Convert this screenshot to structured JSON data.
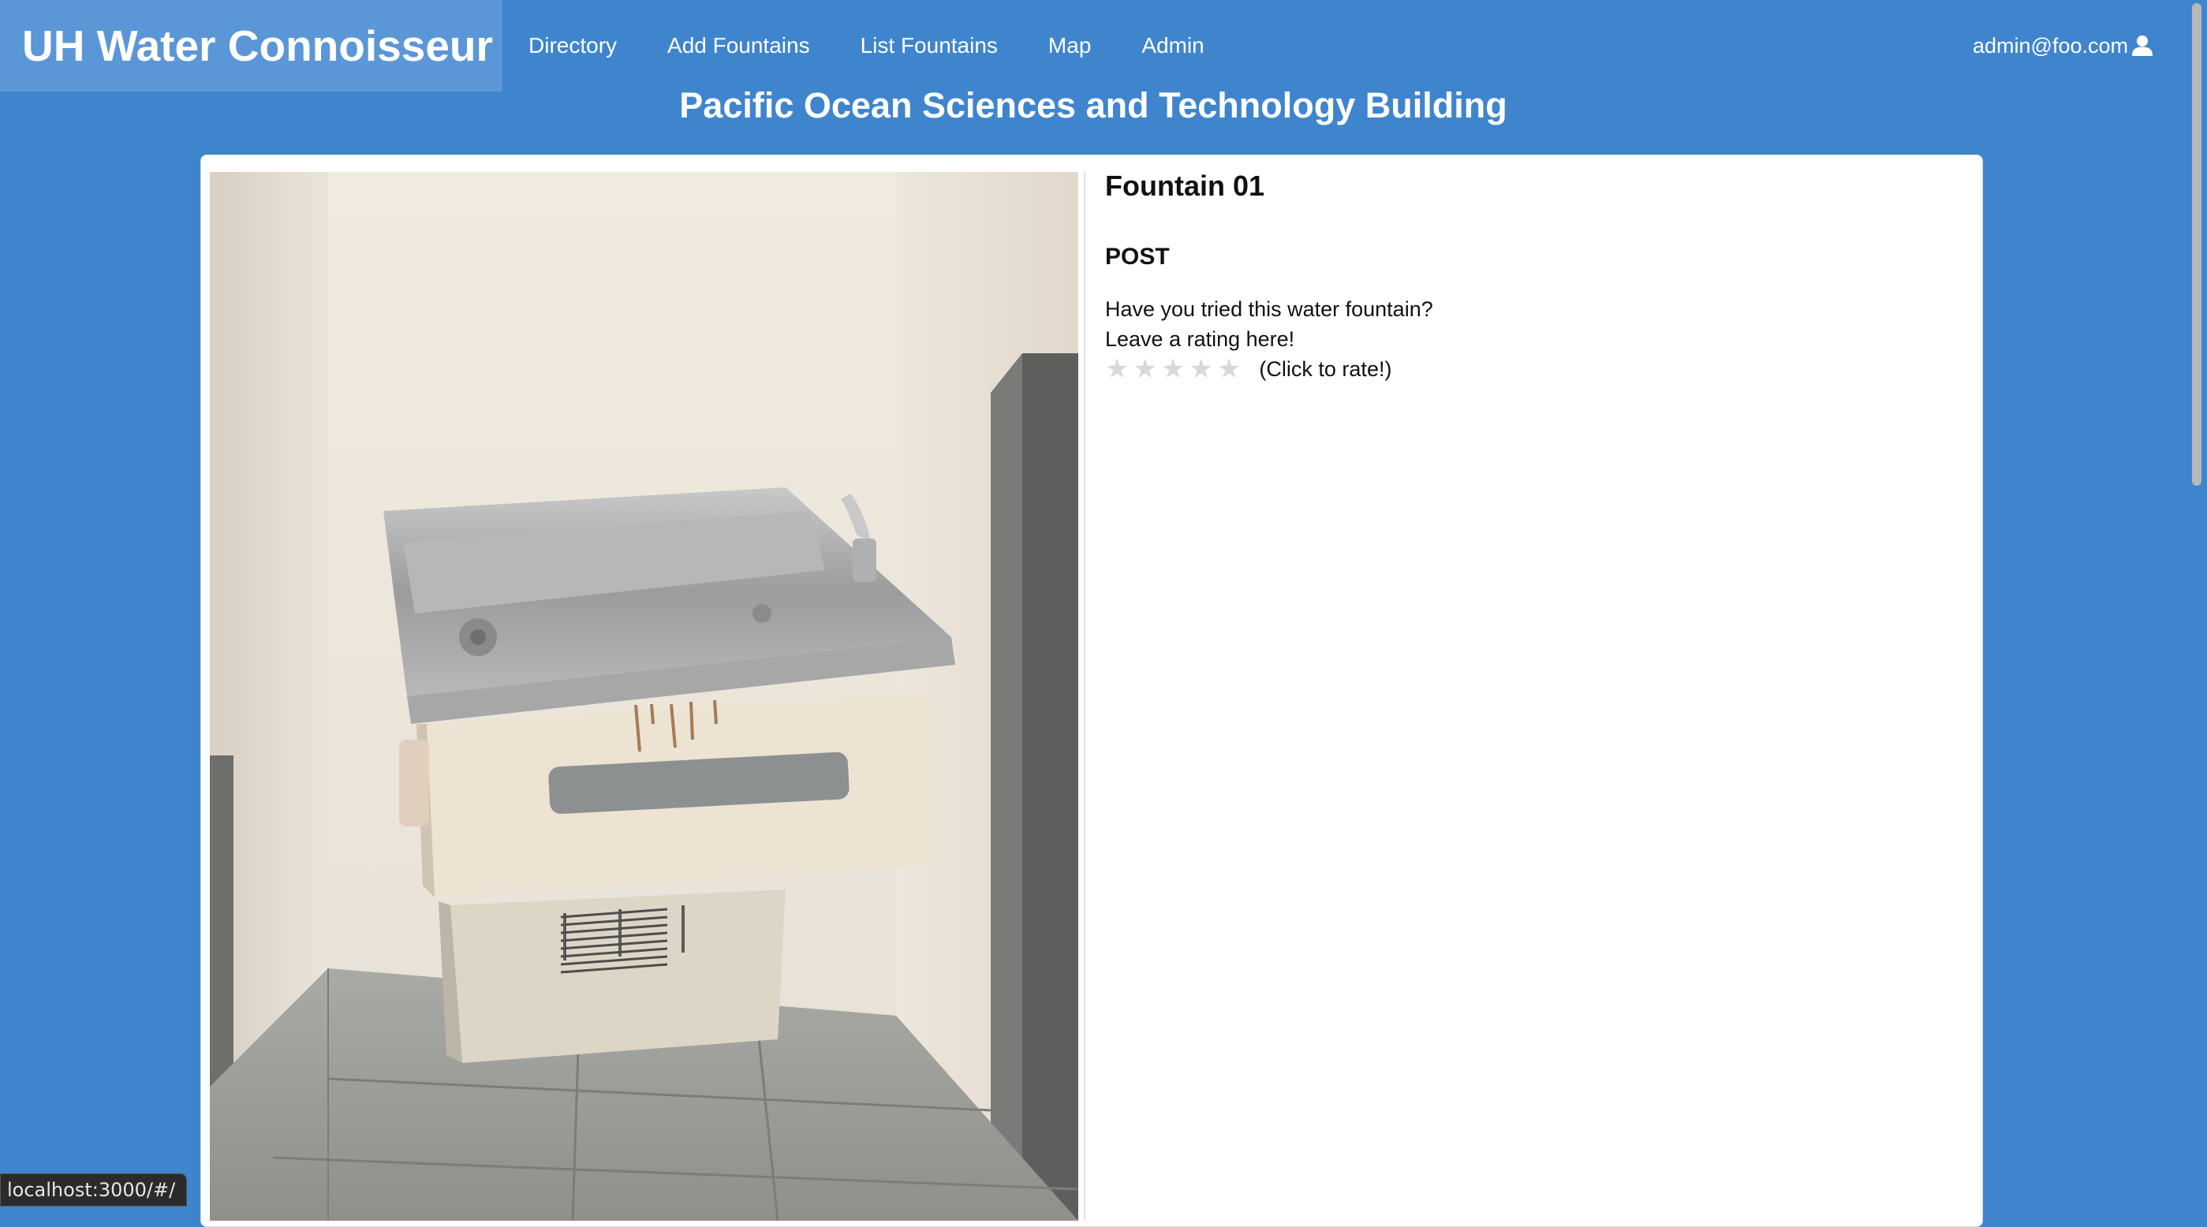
{
  "navbar": {
    "brand": "UH Water Connoisseur",
    "links": [
      {
        "label": "Directory"
      },
      {
        "label": "Add Fountains"
      },
      {
        "label": "List Fountains"
      },
      {
        "label": "Map"
      },
      {
        "label": "Admin"
      }
    ],
    "user_email": "admin@foo.com",
    "user_icon": "user-icon"
  },
  "page": {
    "title": "Pacific Ocean Sciences and Technology Building"
  },
  "fountain": {
    "name": "Fountain 01",
    "section_heading": "POST",
    "prompt_line1": "Have you tried this water fountain?",
    "prompt_line2": "Leave a rating here!",
    "rating": {
      "max_stars": 5,
      "current": 0,
      "hint": "(Click to rate!)"
    },
    "photo_icon": "water-fountain-photo"
  },
  "status_bar": {
    "url": "localhost:3000/#/"
  },
  "colors": {
    "background": "#3f85cd",
    "brand_background": "#5b97d6",
    "card": "#ffffff",
    "star_empty": "#d8d8d8"
  }
}
